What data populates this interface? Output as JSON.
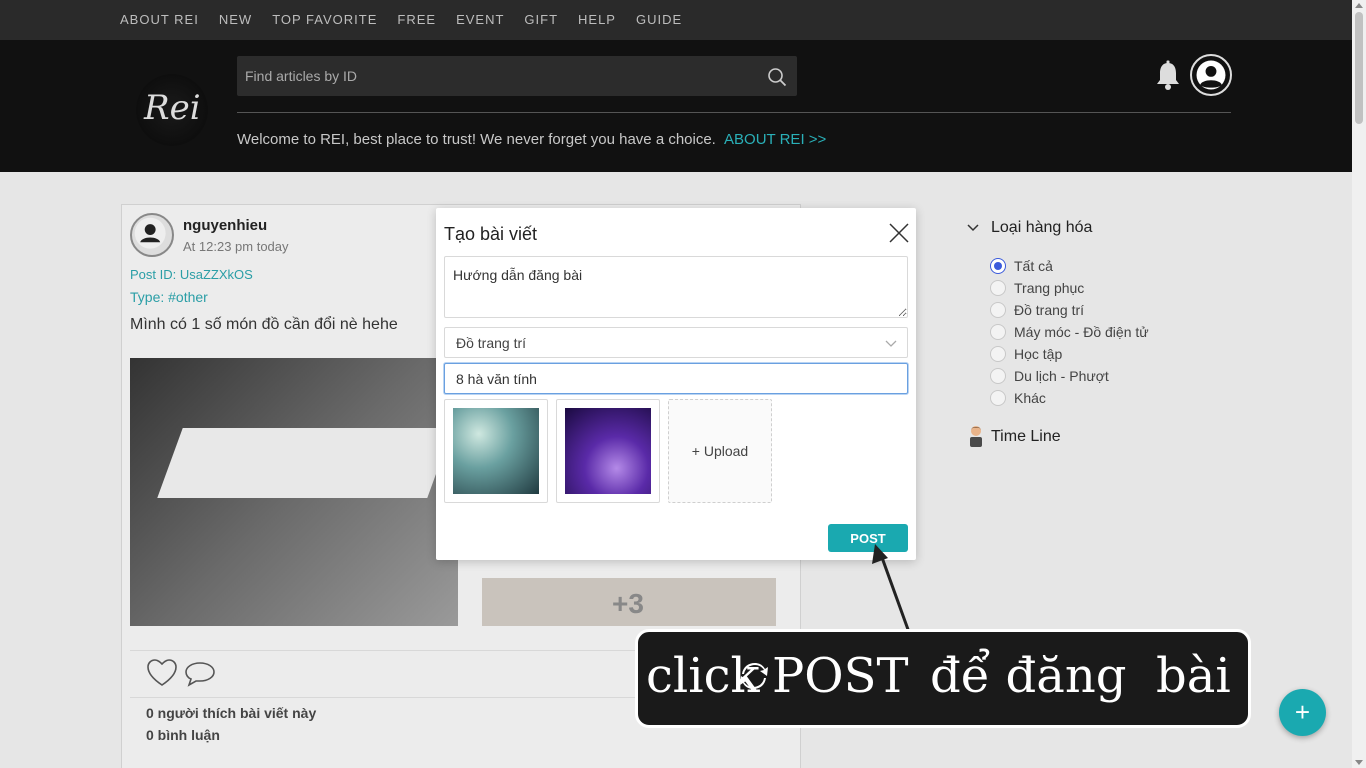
{
  "nav": [
    "ABOUT REI",
    "NEW",
    "TOP FAVORITE",
    "FREE",
    "EVENT",
    "GIFT",
    "HELP",
    "GUIDE"
  ],
  "header": {
    "logo_text": "Rei",
    "search_placeholder": "Find articles by ID",
    "welcome": "Welcome to REI, best place to trust! We never forget you have a choice.",
    "welcome_link": "ABOUT REI >>"
  },
  "post": {
    "username": "nguyenhieu",
    "time": "At 12:23 pm today",
    "post_id": "Post ID: UsaZZXkOS",
    "type": "Type: #other",
    "text": "Mình có 1 số món đồ cần đổi nè hehe",
    "more_photos": "+3",
    "likes": "0 người thích bài viết này",
    "comments": "0 bình luận"
  },
  "sidebar": {
    "category_title": "Loại hàng hóa",
    "options": [
      "Tất cả",
      "Trang phục",
      "Đồ trang trí",
      "Máy móc - Đồ điện tử",
      "Học tập",
      "Du lịch - Phượt",
      "Khác"
    ],
    "selected": 0,
    "timeline": "Time Line"
  },
  "modal": {
    "title": "Tạo bài viết",
    "content_value": "Hướng dẫn đăng bài",
    "select_value": "Đồ trang trí",
    "address_value": "8 hà văn tính",
    "upload_label": "+ Upload",
    "post_label": "POST"
  },
  "annotation": {
    "part1": "click",
    "part2": "POST",
    "part3": "để đăng",
    "part4": "bài"
  },
  "fab_label": "+",
  "colors": {
    "accent": "#1aa9b0",
    "link": "#2ab0b8",
    "header_bg": "#111111",
    "nav_bg": "#2a2a2a"
  }
}
